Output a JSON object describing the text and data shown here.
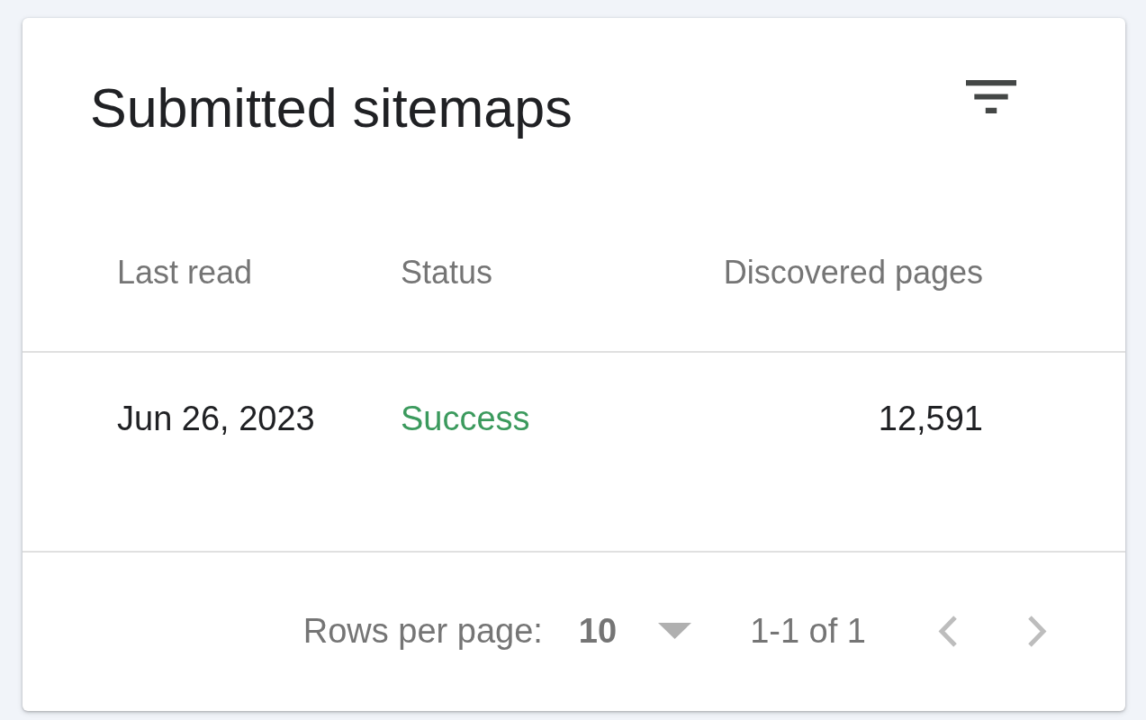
{
  "card": {
    "title": "Submitted sitemaps"
  },
  "table": {
    "columns": [
      "Last read",
      "Status",
      "Discovered pages"
    ],
    "rows": [
      {
        "last_read": "Jun 26, 2023",
        "status": {
          "text": "Success",
          "kind": "success"
        },
        "discovered_pages": "12,591"
      }
    ]
  },
  "pagination": {
    "rows_per_page_label": "Rows per page:",
    "rows_per_page": "10",
    "range": "1-1 of 1",
    "previous": {
      "disabled": true
    },
    "next": {
      "disabled": true
    }
  }
}
